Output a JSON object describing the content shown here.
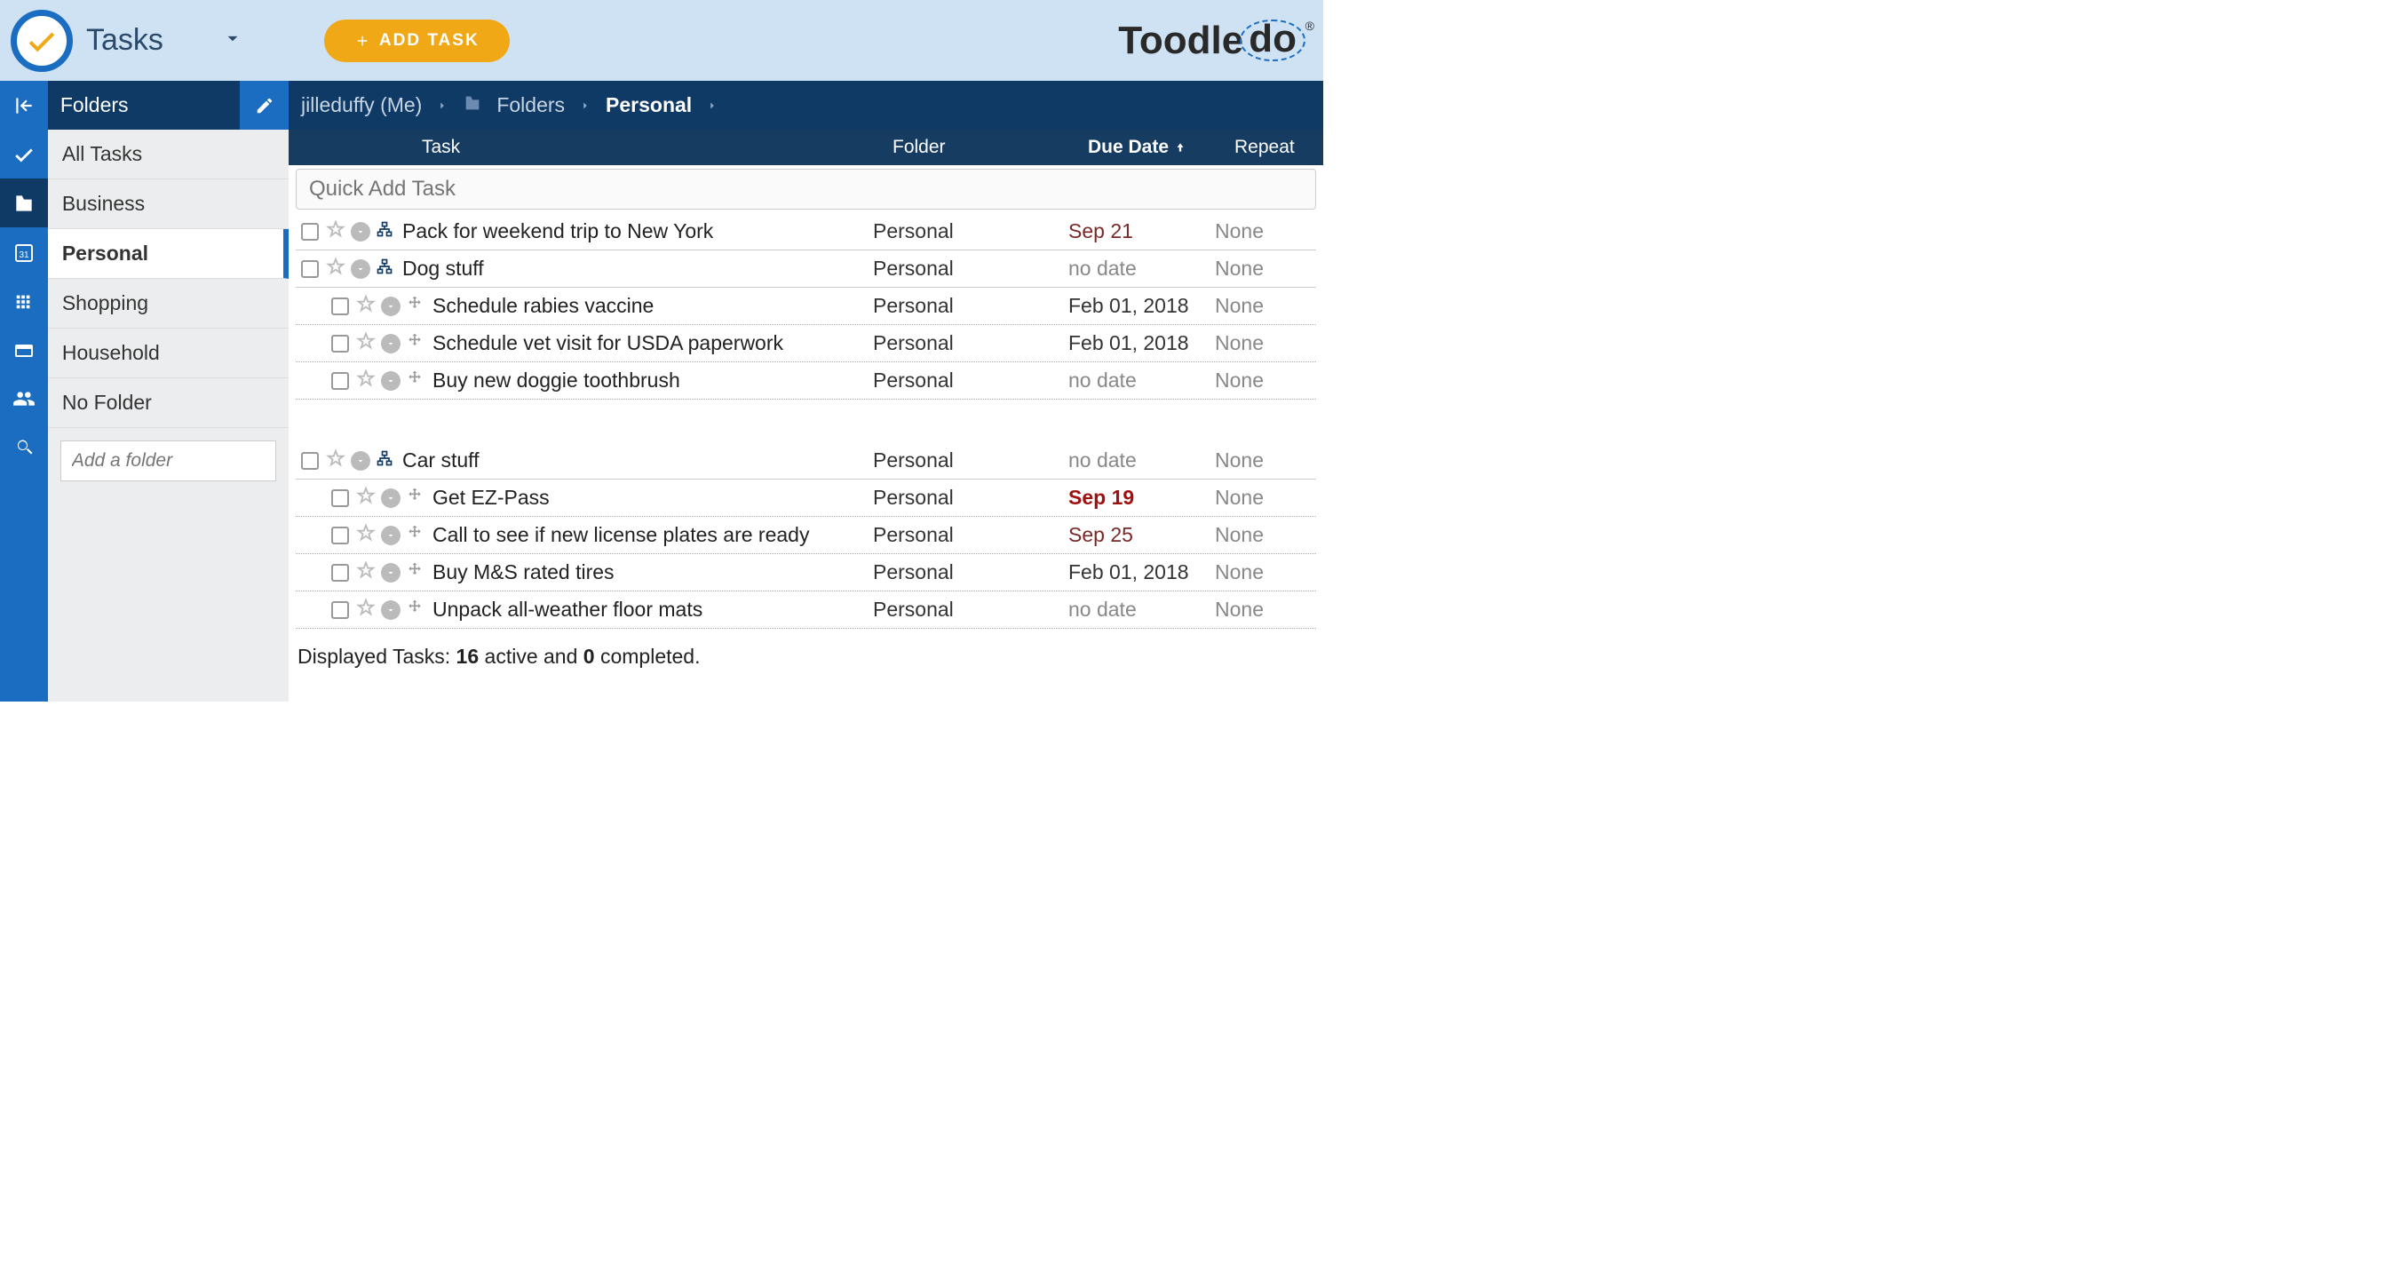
{
  "header": {
    "title": "Tasks",
    "add_task": "ADD TASK",
    "brand_prefix": "Toodle",
    "brand_suffix": "do"
  },
  "sidebar": {
    "header": "Folders",
    "items": [
      {
        "label": "All Tasks",
        "selected": false
      },
      {
        "label": "Business",
        "selected": false
      },
      {
        "label": "Personal",
        "selected": true
      },
      {
        "label": "Shopping",
        "selected": false
      },
      {
        "label": "Household",
        "selected": false
      },
      {
        "label": "No Folder",
        "selected": false
      }
    ],
    "add_folder_placeholder": "Add a folder"
  },
  "breadcrumb": {
    "user": "jilleduffy (Me)",
    "section": "Folders",
    "current": "Personal"
  },
  "columns": {
    "task": "Task",
    "folder": "Folder",
    "due": "Due Date",
    "repeat": "Repeat"
  },
  "quick_add_placeholder": "Quick Add Task",
  "tasks": [
    {
      "level": 0,
      "type": "parent",
      "title": "Pack for weekend trip to New York",
      "folder": "Personal",
      "due": "Sep 21",
      "due_class": "due-soon",
      "repeat": "None"
    },
    {
      "level": 0,
      "type": "parent",
      "title": "Dog stuff",
      "folder": "Personal",
      "due": "no date",
      "due_class": "due-muted",
      "repeat": "None"
    },
    {
      "level": 1,
      "type": "child",
      "title": "Schedule rabies vaccine",
      "folder": "Personal",
      "due": "Feb 01, 2018",
      "due_class": "due-date",
      "repeat": "None"
    },
    {
      "level": 1,
      "type": "child",
      "title": "Schedule vet visit for USDA paperwork",
      "folder": "Personal",
      "due": "Feb 01, 2018",
      "due_class": "due-date",
      "repeat": "None"
    },
    {
      "level": 1,
      "type": "child",
      "title": "Buy new doggie toothbrush",
      "folder": "Personal",
      "due": "no date",
      "due_class": "due-muted",
      "repeat": "None"
    },
    {
      "spacer": true
    },
    {
      "level": 0,
      "type": "parent",
      "title": "Car stuff",
      "folder": "Personal",
      "due": "no date",
      "due_class": "due-muted",
      "repeat": "None"
    },
    {
      "level": 1,
      "type": "child",
      "title": "Get EZ-Pass",
      "folder": "Personal",
      "due": "Sep 19",
      "due_class": "due-overdue",
      "repeat": "None"
    },
    {
      "level": 1,
      "type": "child",
      "title": "Call to see if new license plates are ready",
      "folder": "Personal",
      "due": "Sep 25",
      "due_class": "due-soon",
      "repeat": "None"
    },
    {
      "level": 1,
      "type": "child",
      "title": "Buy M&S rated tires",
      "folder": "Personal",
      "due": "Feb 01, 2018",
      "due_class": "due-date",
      "repeat": "None"
    },
    {
      "level": 1,
      "type": "child",
      "title": "Unpack all-weather floor mats",
      "folder": "Personal",
      "due": "no date",
      "due_class": "due-muted",
      "repeat": "None"
    }
  ],
  "footer": {
    "prefix": "Displayed Tasks: ",
    "active_count": "16",
    "active_label": " active and ",
    "completed_count": "0",
    "completed_label": " completed."
  }
}
